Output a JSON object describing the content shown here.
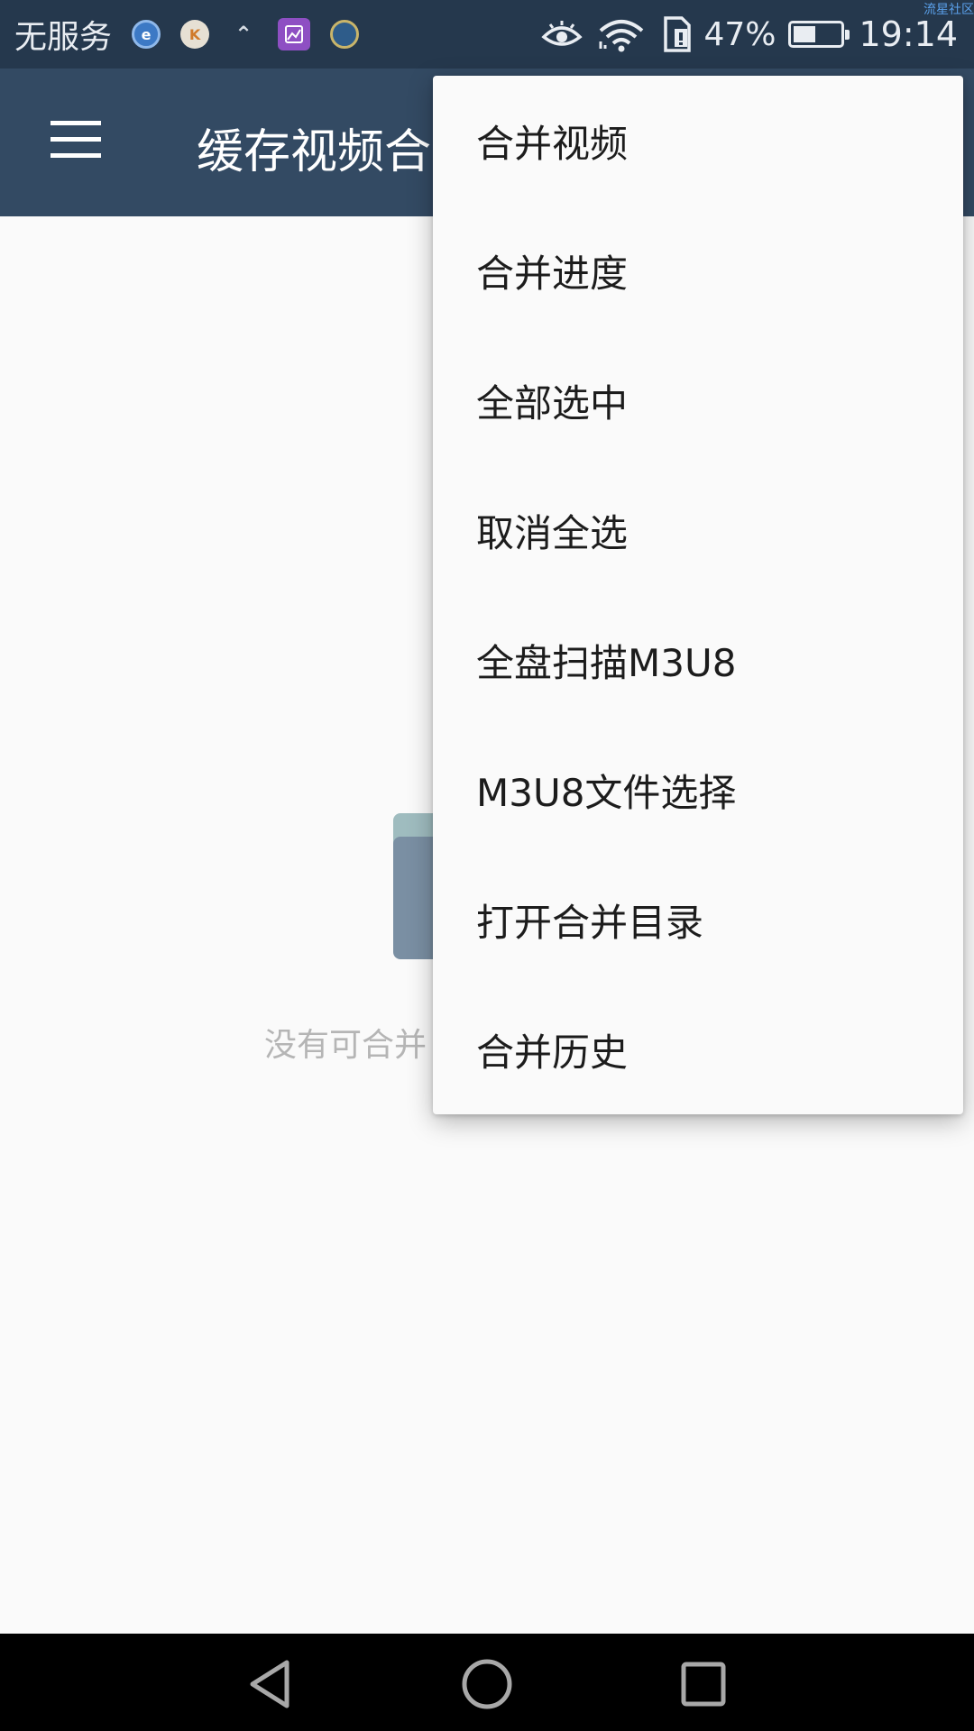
{
  "status_bar": {
    "carrier": "无服务",
    "notification_icons": [
      "browser-icon",
      "k-app-icon",
      "upload-icon",
      "gallery-icon",
      "globe-app-icon"
    ],
    "battery_percent": "47%",
    "battery_level": 0.47,
    "time": "19:14",
    "watermark": "流星社区"
  },
  "toolbar": {
    "title": "缓存视频合"
  },
  "empty_state": {
    "message": "没有可合并"
  },
  "menu": {
    "items": [
      {
        "label": "合并视频"
      },
      {
        "label": "合并进度"
      },
      {
        "label": "全部选中"
      },
      {
        "label": "取消全选"
      },
      {
        "label": "全盘扫描M3U8"
      },
      {
        "label": "M3U8文件选择"
      },
      {
        "label": "打开合并目录"
      },
      {
        "label": "合并历史"
      }
    ]
  },
  "colors": {
    "status_bar": "#25384d",
    "toolbar": "#334a63",
    "background": "#fafafa",
    "menu_background": "#fafafa",
    "nav_bar": "#000000"
  }
}
